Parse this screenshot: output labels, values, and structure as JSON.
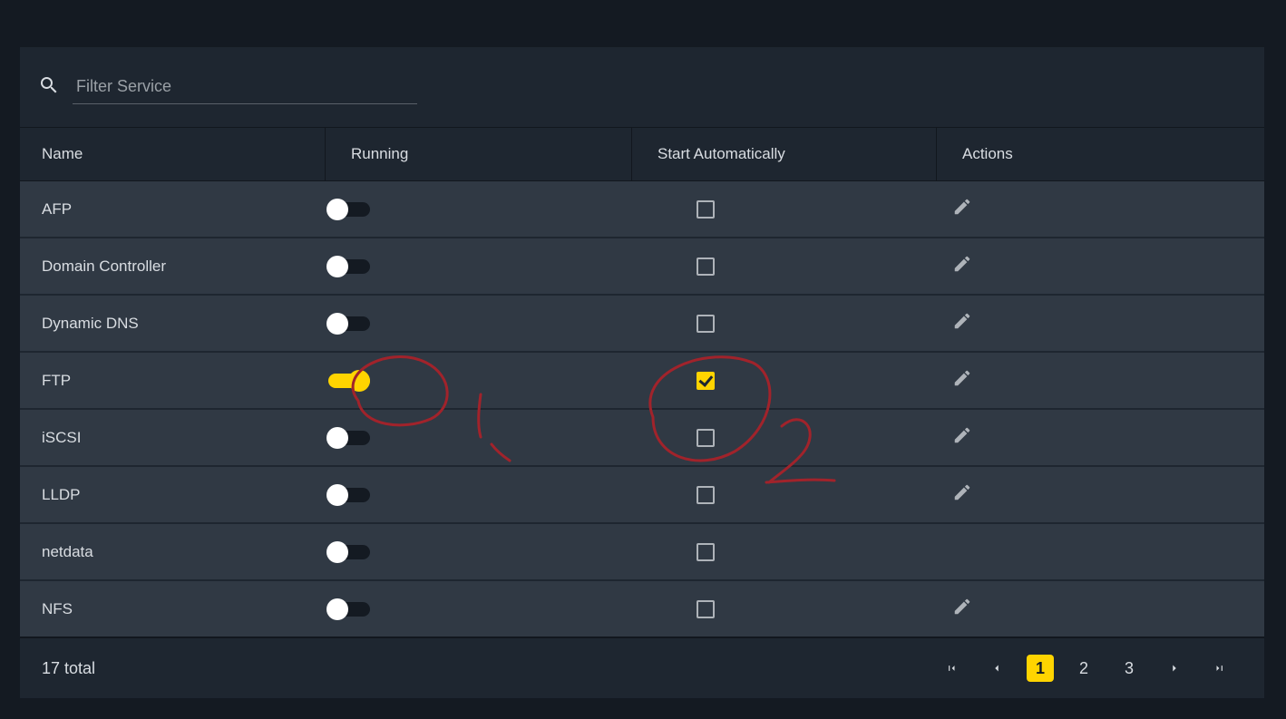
{
  "filter": {
    "placeholder": "Filter Service",
    "value": ""
  },
  "columns": {
    "name": "Name",
    "running": "Running",
    "auto": "Start Automatically",
    "actions": "Actions"
  },
  "services": [
    {
      "name": "AFP",
      "running": false,
      "auto": false,
      "editable": true
    },
    {
      "name": "Domain Controller",
      "running": false,
      "auto": false,
      "editable": true
    },
    {
      "name": "Dynamic DNS",
      "running": false,
      "auto": false,
      "editable": true
    },
    {
      "name": "FTP",
      "running": true,
      "auto": true,
      "editable": true
    },
    {
      "name": "iSCSI",
      "running": false,
      "auto": false,
      "editable": true
    },
    {
      "name": "LLDP",
      "running": false,
      "auto": false,
      "editable": true
    },
    {
      "name": "netdata",
      "running": false,
      "auto": false,
      "editable": false
    },
    {
      "name": "NFS",
      "running": false,
      "auto": false,
      "editable": true
    }
  ],
  "footer": {
    "total_text": "17 total"
  },
  "pager": {
    "pages": [
      "1",
      "2",
      "3"
    ],
    "active": "1"
  },
  "annotations": {
    "label1": "1",
    "label2": "2"
  }
}
